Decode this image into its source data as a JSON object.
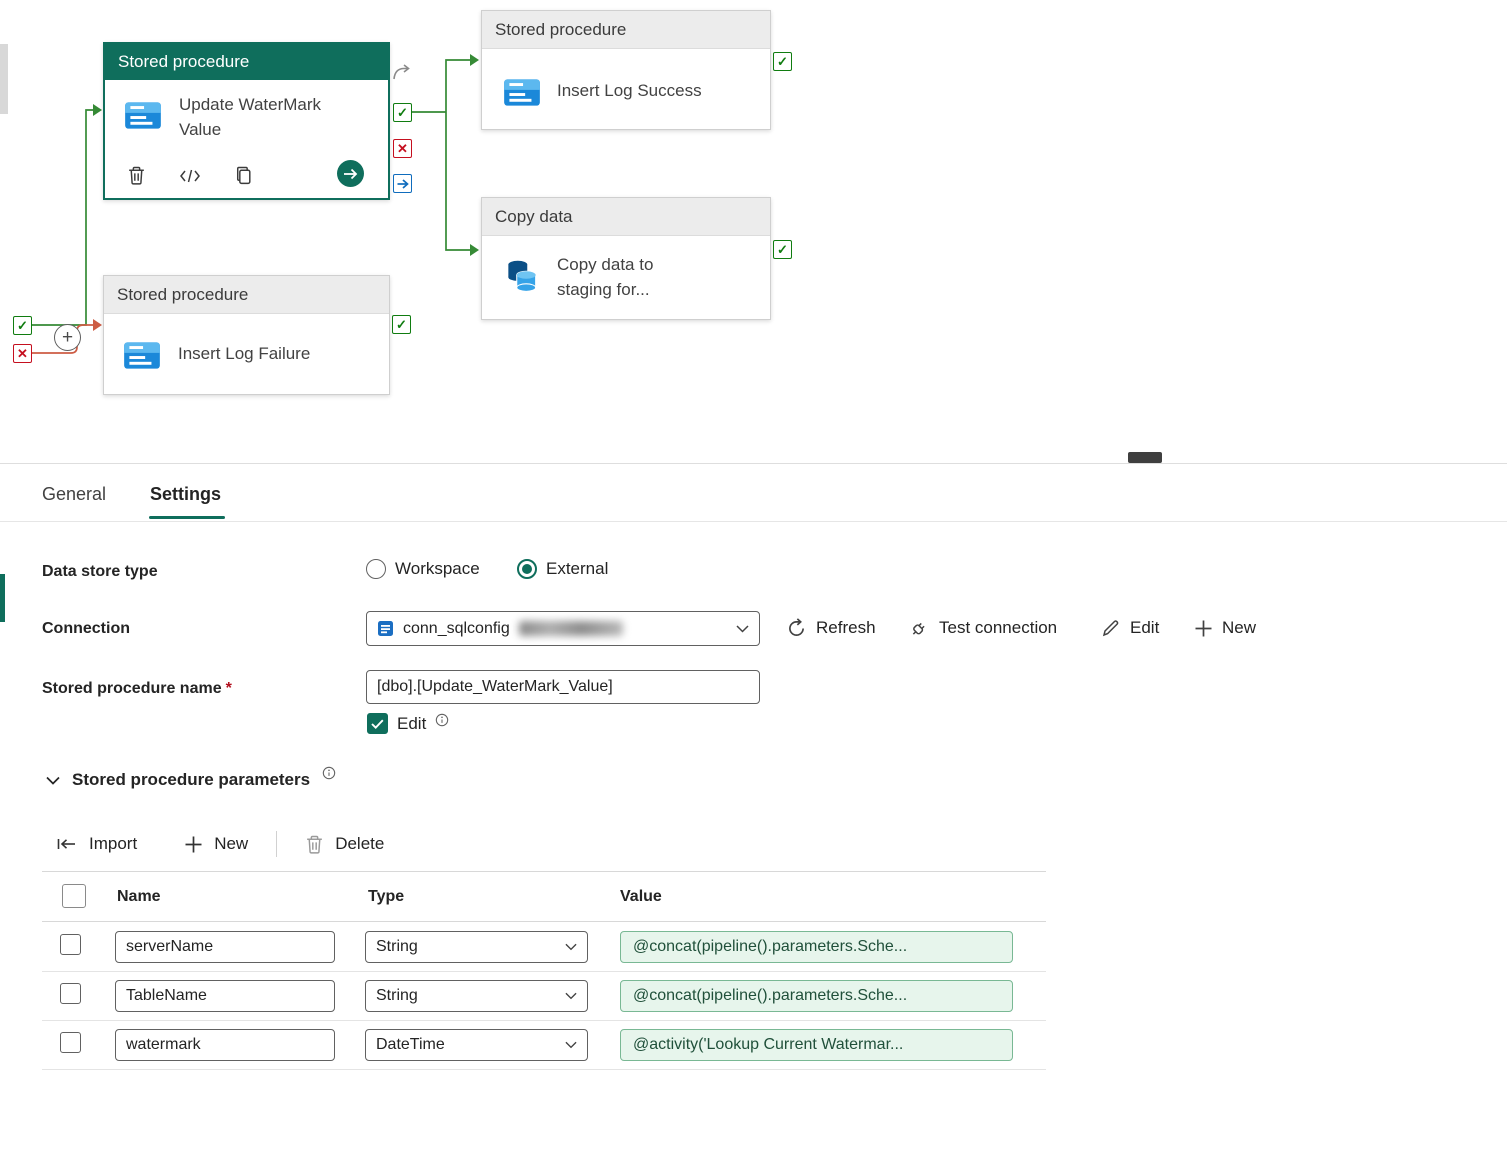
{
  "colors": {
    "accent": "#0f6e5c",
    "success": "#107c10",
    "error": "#c50f1f",
    "link_blue": "#0f6cbd",
    "value_bg": "#e7f5ec"
  },
  "canvas": {
    "nodes": {
      "update_watermark": {
        "header": "Stored procedure",
        "title": "Update WaterMark Value"
      },
      "insert_log_success": {
        "header": "Stored procedure",
        "title": "Insert Log Success"
      },
      "copy_data": {
        "header": "Copy data",
        "title": "Copy data to staging for..."
      },
      "insert_log_failure": {
        "header": "Stored procedure",
        "title": "Insert Log Failure"
      }
    }
  },
  "panel": {
    "tabs": {
      "general": "General",
      "settings": "Settings"
    },
    "data_store_type": {
      "label": "Data store type",
      "workspace": "Workspace",
      "external": "External"
    },
    "connection": {
      "label": "Connection",
      "value": "conn_sqlconfig",
      "refresh": "Refresh",
      "test": "Test connection",
      "edit": "Edit",
      "new": "New"
    },
    "stored_procedure_name": {
      "label": "Stored procedure name",
      "required": "*",
      "value": "[dbo].[Update_WaterMark_Value]",
      "edit": "Edit"
    },
    "parameters": {
      "title": "Stored procedure parameters",
      "toolbar": {
        "import": "Import",
        "new": "New",
        "delete": "Delete"
      },
      "columns": {
        "name": "Name",
        "type": "Type",
        "value": "Value"
      },
      "rows": [
        {
          "name": "serverName",
          "type": "String",
          "value": "@concat(pipeline().parameters.Sche..."
        },
        {
          "name": "TableName",
          "type": "String",
          "value": "@concat(pipeline().parameters.Sche..."
        },
        {
          "name": "watermark",
          "type": "DateTime",
          "value": "@activity('Lookup Current Watermar..."
        }
      ]
    }
  }
}
